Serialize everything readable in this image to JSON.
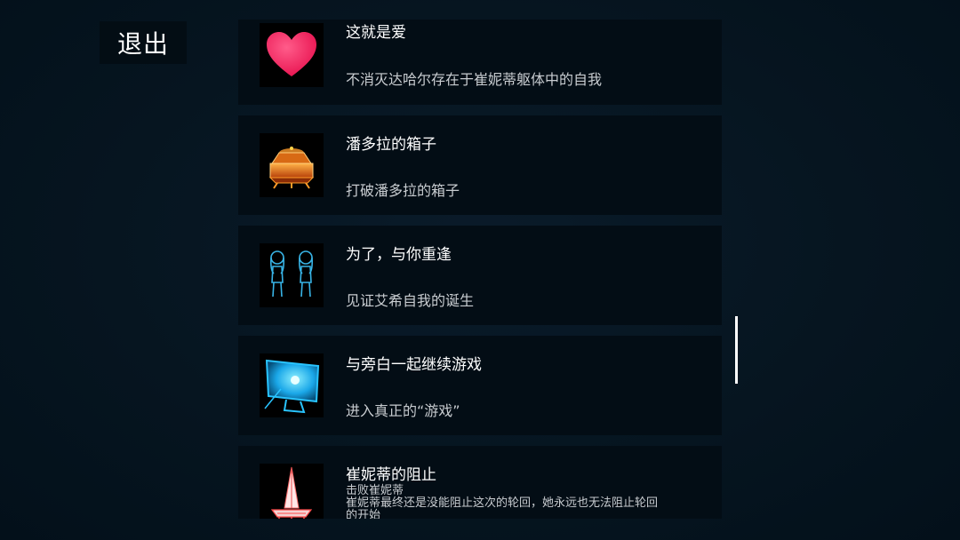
{
  "header": {
    "exit_label": "退出"
  },
  "achievements": [
    {
      "icon": "heart-icon",
      "title": "这就是爱",
      "description": "不消灭达哈尔存在于崔妮蒂躯体中的自我"
    },
    {
      "icon": "pandora-box-icon",
      "title": "潘多拉的箱子",
      "description": "打破潘多拉的箱子"
    },
    {
      "icon": "twin-figures-icon",
      "title": "为了，与你重逢",
      "description": "见证艾希自我的诞生"
    },
    {
      "icon": "monitor-icon",
      "title": "与旁白一起继续游戏",
      "description": "进入真正的“游戏”"
    },
    {
      "icon": "tower-icon",
      "title": "崔妮蒂的阻止",
      "description_line1": "击败崔妮蒂",
      "description_line2": "崔妮蒂最终还是没能阻止这次的轮回，她永远也无法阻止轮回",
      "description_line3": "的开始"
    }
  ],
  "colors": {
    "background": "#061520",
    "card": "#030d15",
    "heart": "#ff2e6b",
    "cyan": "#29c4ff",
    "orange": "#ff8a1e"
  }
}
